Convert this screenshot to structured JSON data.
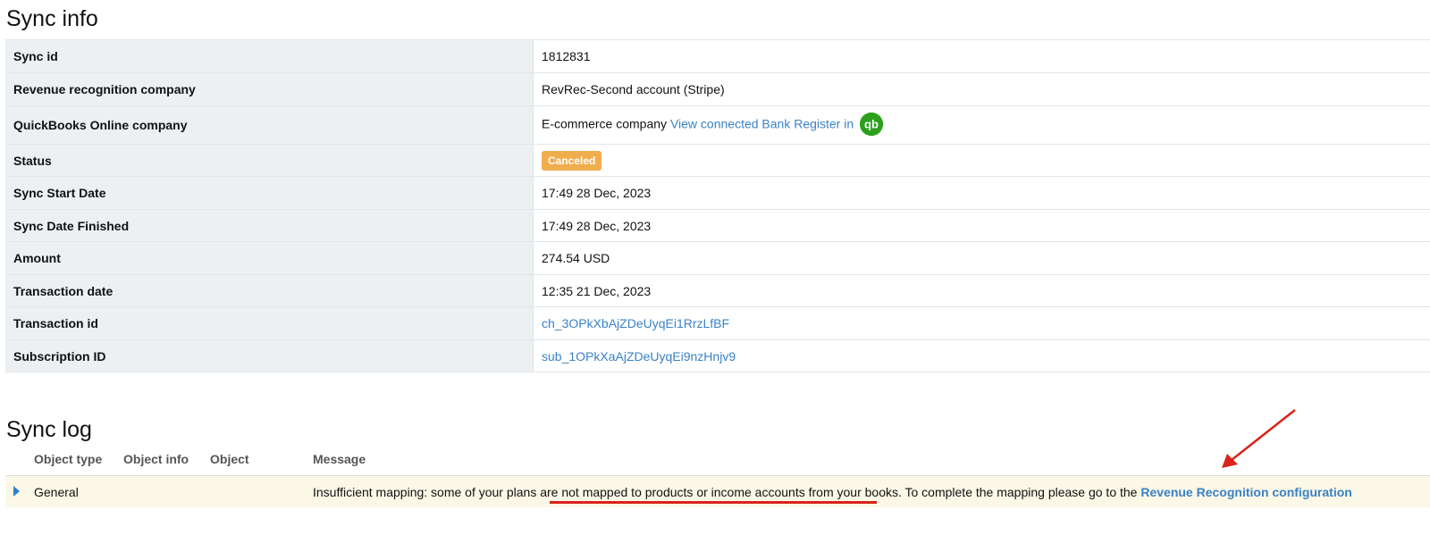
{
  "sync_info": {
    "title": "Sync info",
    "rows": [
      {
        "label": "Sync id",
        "value": "1812831"
      },
      {
        "label": "Revenue recognition company",
        "value": "RevRec-Second account (Stripe)"
      },
      {
        "label": "QuickBooks Online company",
        "value": "E-commerce company",
        "link": "View connected Bank Register in"
      },
      {
        "label": "Status",
        "value": "Canceled"
      },
      {
        "label": "Sync Start Date",
        "value": "17:49 28 Dec, 2023"
      },
      {
        "label": "Sync Date Finished",
        "value": "17:49 28 Dec, 2023"
      },
      {
        "label": "Amount",
        "value": "274.54 USD"
      },
      {
        "label": "Transaction date",
        "value": "12:35 21 Dec, 2023"
      },
      {
        "label": "Transaction id",
        "value": "ch_3OPkXbAjZDeUyqEi1RrzLfBF"
      },
      {
        "label": "Subscription ID",
        "value": "sub_1OPkXaAjZDeUyqEi9nzHnjv9"
      }
    ],
    "status_color": "#f0ad4e",
    "qb_icon": "quickbooks-logo-icon",
    "qb_icon_text": "qb"
  },
  "sync_log": {
    "title": "Sync log",
    "columns": [
      "Object type",
      "Object info",
      "Object",
      "Message"
    ],
    "rows": [
      {
        "object_type": "General",
        "object_info": "",
        "object": "",
        "message_before": "Insufficient mapping: some of your plans are not mapped to products or income accounts from your books. To complete the mapping please go to the ",
        "message_link": "Revenue Recognition configuration"
      }
    ],
    "expand_icon": "expand-triangle-icon"
  },
  "annotations": {
    "color": "#d9231b",
    "arrow_icon": "red-arrow-icon"
  }
}
